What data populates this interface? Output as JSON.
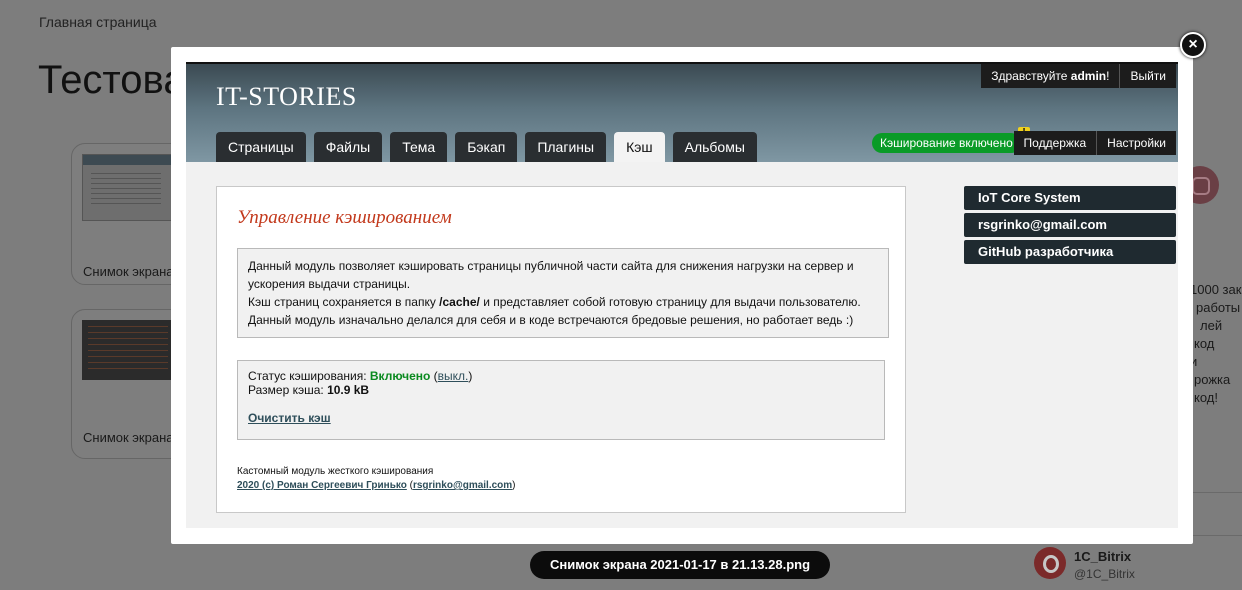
{
  "background": {
    "breadcrumb": "Главная страница",
    "title": "Тестова",
    "cards": [
      {
        "label": "Снимок экрана"
      },
      {
        "label": "Снимок экрана"
      }
    ],
    "side_text": [
      "1000 зака",
      "работы",
      "лей",
      "код",
      "и",
      "рожка",
      "код!"
    ],
    "bitrix": {
      "name": "1C_Bitrix",
      "handle": "@1C_Bitrix"
    }
  },
  "modal": {
    "close": "×",
    "logo": "IT-STORIES",
    "topbar": {
      "greeting_prefix": "Здравствуйте",
      "user": "admin",
      "greeting_suffix": "!",
      "logout": "Выйти"
    },
    "tabs": [
      "Страницы",
      "Файлы",
      "Тема",
      "Бэкап",
      "Плагины",
      "Кэш",
      "Альбомы"
    ],
    "active_tab": "Кэш",
    "cache_badge": "Кэширование включено",
    "warning": "!",
    "right_menu": [
      "Поддержка",
      "Настройки"
    ],
    "panel": {
      "title": "Управление кэшированием",
      "desc_line1": "Данный модуль позволяет кэшировать страницы публичной части сайта для снижения нагрузки на сервер и ускорения выдачи страницы.",
      "desc_line2_a": "Кэш страниц сохраняется в папку ",
      "desc_line2_path": "/cache/",
      "desc_line2_b": " и представляет собой готовую страницу для выдачи пользователю.",
      "desc_line3": "Данный модуль изначально делался для себя и в коде встречаются бредовые решения, но работает ведь :)",
      "status_label": "Статус кэширования: ",
      "status_value": "Включено",
      "status_toggle": "выкл.",
      "size_label": "Размер кэша: ",
      "size_value": "10.9 kB",
      "clear_cache": "Очистить кэш",
      "footer_text": "Кастомный модуль жесткого кэширования",
      "footer_author": "2020 (c) Роман Сергеевич Гринько",
      "footer_email": "rsgrinko@gmail.com"
    },
    "side_links": [
      "IoT Core System",
      "rsgrinko@gmail.com",
      "GitHub разработчика"
    ]
  },
  "caption": "Снимок экрана 2021-01-17 в 21.13.28.png"
}
